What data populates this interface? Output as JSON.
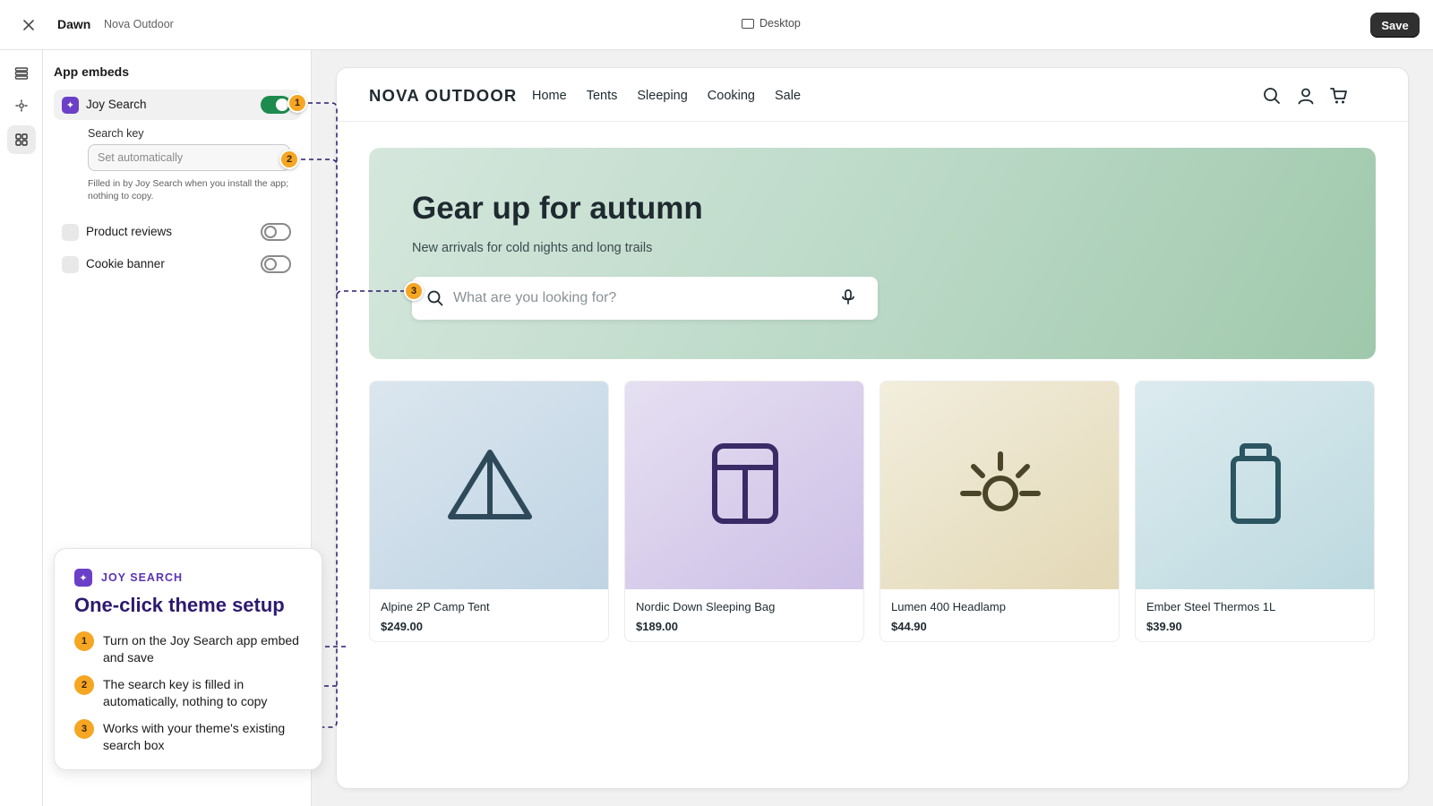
{
  "topbar": {
    "theme_name": "Dawn",
    "store_name": "Nova Outdoor",
    "device_label": "Desktop",
    "save_label": "Save"
  },
  "panel": {
    "title": "App embeds",
    "embeds": [
      {
        "label": "Joy Search",
        "enabled": true
      },
      {
        "label": "Product reviews",
        "enabled": false
      },
      {
        "label": "Cookie banner",
        "enabled": false
      }
    ],
    "search_key": {
      "label": "Search key",
      "placeholder": "Set automatically",
      "help": "Filled in by Joy Search when you install the app; nothing to copy."
    }
  },
  "callouts": [
    "1",
    "2",
    "3"
  ],
  "store": {
    "logo": "NOVA OUTDOOR",
    "nav": [
      "Home",
      "Tents",
      "Sleeping",
      "Cooking",
      "Sale"
    ],
    "hero": {
      "title": "Gear up for autumn",
      "subtitle": "New arrivals for cold nights and long trails",
      "search_placeholder": "What are you looking for?"
    },
    "products": [
      {
        "name": "Alpine 2P Camp Tent",
        "price": "$249.00",
        "icon": "tent-icon"
      },
      {
        "name": "Nordic Down Sleeping Bag",
        "price": "$189.00",
        "icon": "sleeping-bag-icon"
      },
      {
        "name": "Lumen 400 Headlamp",
        "price": "$44.90",
        "icon": "headlamp-icon"
      },
      {
        "name": "Ember Steel Thermos 1L",
        "price": "$39.90",
        "icon": "thermos-icon"
      }
    ]
  },
  "info_card": {
    "brand": "JOY SEARCH",
    "title": "One-click theme setup",
    "steps": [
      {
        "num": "1",
        "text": "Turn on the Joy Search app embed and save"
      },
      {
        "num": "2",
        "text": "The search key is filled in automatically, nothing to copy"
      },
      {
        "num": "3",
        "text": "Works with your theme's existing search box"
      }
    ]
  },
  "colors": {
    "brand_purple": "#6b3fc7",
    "toggle_on": "#1d8a4e",
    "callout_orange": "#f5a623",
    "connector": "#2d1a6e"
  }
}
